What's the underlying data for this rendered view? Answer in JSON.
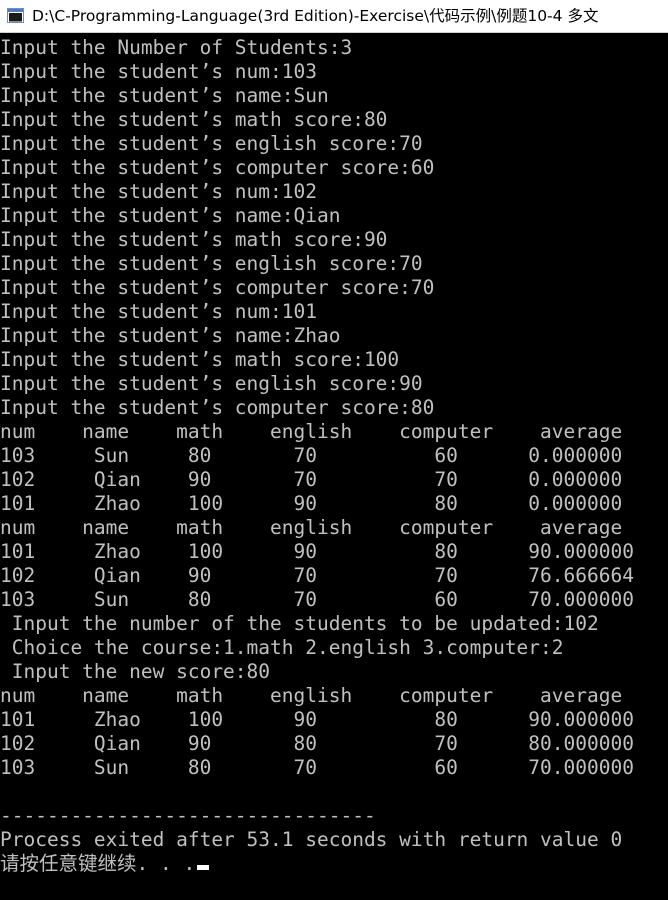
{
  "window": {
    "title": "D:\\C-Programming-Language(3rd Edition)-Exercise\\代码示例\\例题10-4 多文"
  },
  "console": {
    "lines": [
      "Input the Number of Students:3",
      "Input the student’s num:103",
      "Input the student’s name:Sun",
      "Input the student’s math score:80",
      "Input the student’s english score:70",
      "Input the student’s computer score:60",
      "Input the student’s num:102",
      "Input the student’s name:Qian",
      "Input the student’s math score:90",
      "Input the student’s english score:70",
      "Input the student’s computer score:70",
      "Input the student’s num:101",
      "Input the student’s name:Zhao",
      "Input the student’s math score:100",
      "Input the student’s english score:90",
      "Input the student’s computer score:80",
      "num    name    math    english    computer    average",
      "103     Sun     80       70          60      0.000000",
      "102     Qian    90       70          70      0.000000",
      "101     Zhao    100      90          80      0.000000",
      "num    name    math    english    computer    average",
      "101     Zhao    100      90          80      90.000000",
      "102     Qian    90       70          70      76.666664",
      "103     Sun     80       70          60      70.000000",
      " Input the number of the students to be updated:102",
      " Choice the course:1.math 2.english 3.computer:2",
      " Input the new score:80",
      "num    name    math    english    computer    average",
      "101     Zhao    100      90          80      90.000000",
      "102     Qian    90       80          70      80.000000",
      "103     Sun     80       70          60      70.000000",
      "",
      "--------------------------------",
      "Process exited after 53.1 seconds with return value 0"
    ],
    "prompt": "请按任意键继续. . ."
  }
}
